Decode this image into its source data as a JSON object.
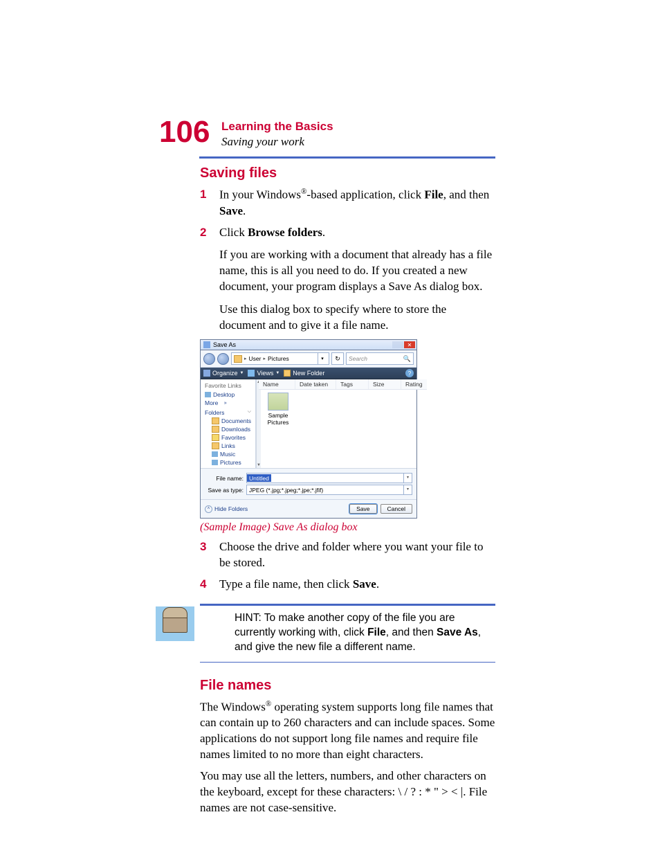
{
  "page_number": "106",
  "header": {
    "chapter": "Learning the Basics",
    "section": "Saving your work"
  },
  "section1": {
    "heading": "Saving files",
    "steps": {
      "s1": {
        "num": "1",
        "p1a": "In your Windows",
        "p1sup": "®",
        "p1b": "-based application, click ",
        "p1bold1": "File",
        "p1c": ", and then ",
        "p1bold2": "Save",
        "p1d": "."
      },
      "s2": {
        "num": "2",
        "p1a": "Click ",
        "p1bold1": "Browse folders",
        "p1b": ".",
        "p2": "If you are working with a document that already has a file name, this is all you need to do. If you created a new document, your program displays a Save As dialog box.",
        "p3": "Use this dialog box to specify where to store the document and to give it a file name."
      },
      "s3": {
        "num": "3",
        "text": "Choose the drive and folder where you want your file to be stored."
      },
      "s4": {
        "num": "4",
        "p1a": "Type a file name, then click ",
        "p1bold": "Save",
        "p1b": "."
      }
    },
    "caption": "(Sample Image) Save As dialog box"
  },
  "dialog": {
    "title": "Save As",
    "breadcrumb": {
      "seg1": "User",
      "seg2": "Pictures"
    },
    "search_placeholder": "Search",
    "toolbar": {
      "organize": "Organize",
      "views": "Views",
      "new_folder": "New Folder"
    },
    "fav_header": "Favorite Links",
    "fav": {
      "desktop": "Desktop",
      "more": "More"
    },
    "folders_header": "Folders",
    "folders": {
      "documents": "Documents",
      "downloads": "Downloads",
      "favorites": "Favorites",
      "links": "Links",
      "music": "Music",
      "pictures": "Pictures"
    },
    "columns": {
      "name": "Name",
      "date": "Date taken",
      "tags": "Tags",
      "size": "Size",
      "rating": "Rating"
    },
    "sample_item": "Sample Pictures",
    "file_name_label": "File name:",
    "file_name_value": "Untitled",
    "save_type_label": "Save as type:",
    "save_type_value": "JPEG (*.jpg;*.jpeg;*.jpe;*.jfif)",
    "hide_folders": "Hide Folders",
    "save_btn": "Save",
    "cancel_btn": "Cancel"
  },
  "hint": {
    "prefix": "HINT: To make another copy of the file you are currently working with, click ",
    "bold1": "File",
    "mid": ", and then ",
    "bold2": "Save As",
    "suffix": ", and give the new file a different name."
  },
  "section2": {
    "heading": "File names",
    "p1a": "The Windows",
    "p1sup": "®",
    "p1b": " operating system supports long file names that can contain up to 260 characters and can include spaces. Some applications do not support long file names and require file names limited to no more than eight characters.",
    "p2": "You may use all the letters, numbers, and other characters on the keyboard, except for these characters: \\ / ? : * \" > <  |. File names are not case-sensitive."
  }
}
